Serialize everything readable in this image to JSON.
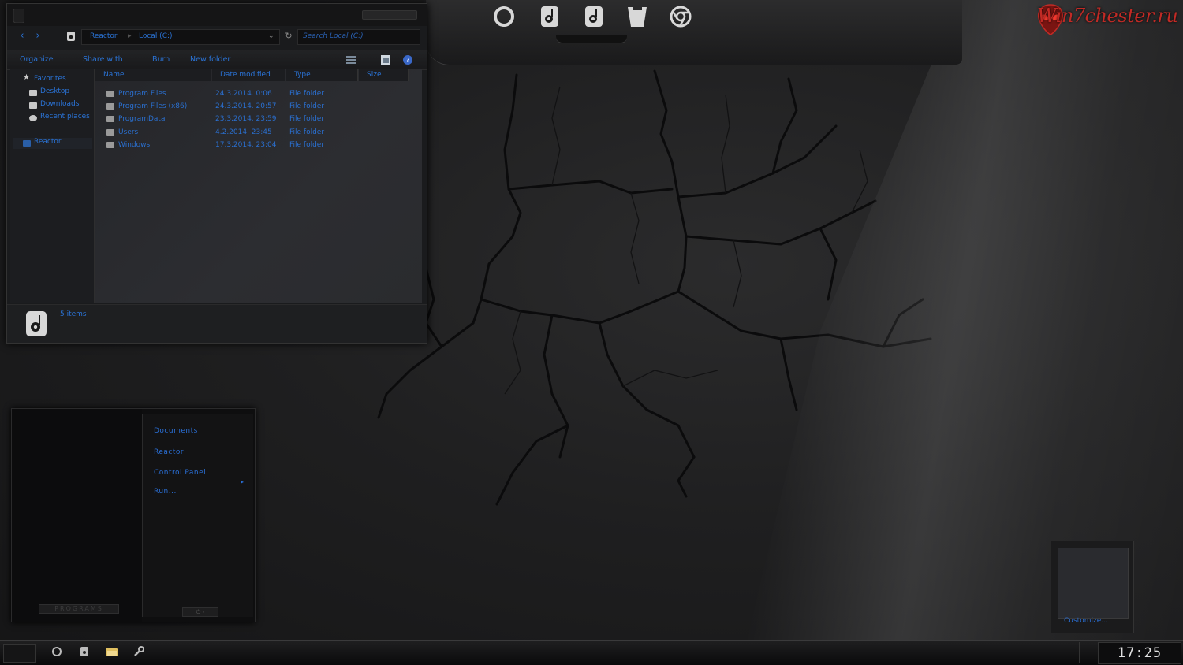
{
  "watermark": {
    "text": "Win7chester.ru"
  },
  "top_dock": {
    "icons": [
      {
        "name": "ring-icon"
      },
      {
        "name": "disk-icon"
      },
      {
        "name": "disk-icon-2"
      },
      {
        "name": "cup-icon"
      },
      {
        "name": "chrome-icon"
      }
    ]
  },
  "explorer": {
    "address": {
      "crumbs": [
        "Reactor",
        "Local (C:)"
      ]
    },
    "search_placeholder": "Search Local (C:)",
    "toolbar": {
      "organize": "Organize",
      "share_with": "Share with",
      "burn": "Burn",
      "new_folder": "New folder"
    },
    "nav_pane": {
      "favorites": "Favorites",
      "desktop": "Desktop",
      "downloads": "Downloads",
      "recent_places": "Recent places",
      "reactor": "Reactor"
    },
    "columns": {
      "name": "Name",
      "date_modified": "Date modified",
      "type": "Type",
      "size": "Size"
    },
    "rows": [
      {
        "name": "Program Files",
        "date": "24.3.2014. 0:06",
        "type": "File folder"
      },
      {
        "name": "Program Files (x86)",
        "date": "24.3.2014. 20:57",
        "type": "File folder"
      },
      {
        "name": "ProgramData",
        "date": "23.3.2014. 23:59",
        "type": "File folder"
      },
      {
        "name": "Users",
        "date": "4.2.2014. 23:45",
        "type": "File folder"
      },
      {
        "name": "Windows",
        "date": "17.3.2014. 23:04",
        "type": "File folder"
      }
    ],
    "status": "5 items"
  },
  "start_menu": {
    "items": {
      "documents": "Documents",
      "reactor": "Reactor",
      "control_panel": "Control Panel",
      "run": "Run..."
    },
    "programs_label": "PROGRAMS"
  },
  "gadget": {
    "label": "Customize..."
  },
  "taskbar": {
    "clock": "17:25"
  },
  "colors": {
    "accent": "#2a73d6",
    "background": "#1b1b1c"
  }
}
